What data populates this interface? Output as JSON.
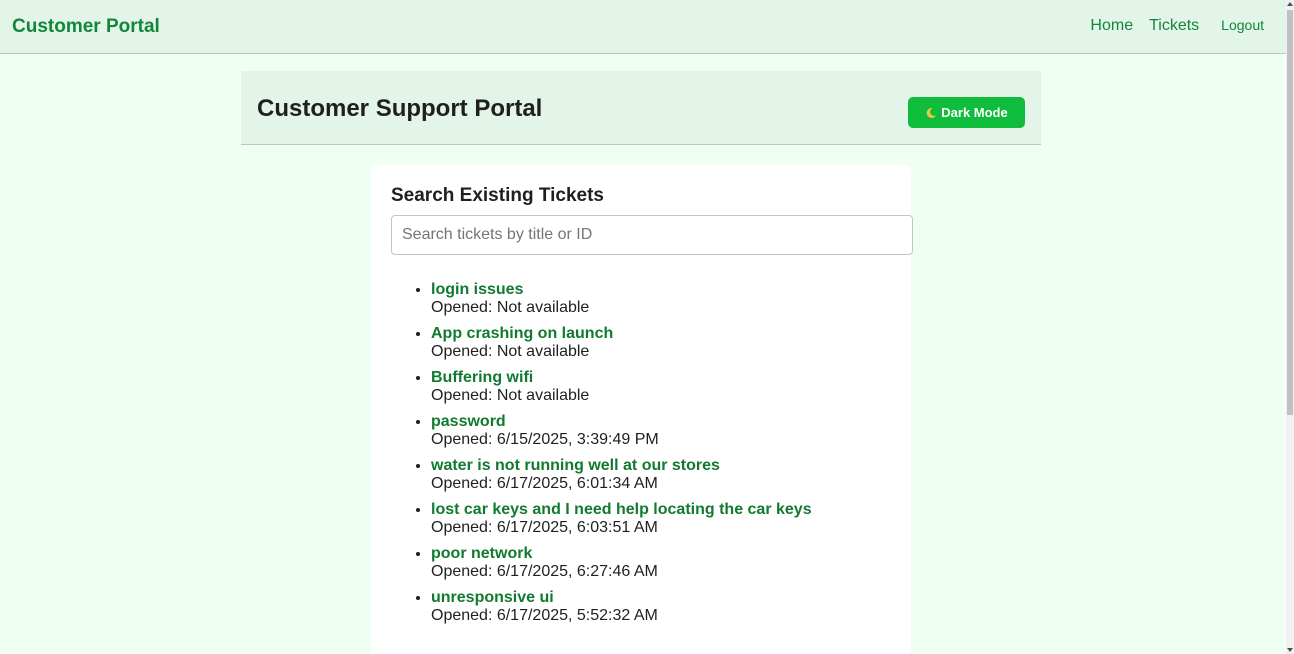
{
  "nav": {
    "brand": "Customer Portal",
    "links": [
      "Home",
      "Tickets"
    ],
    "logout": "Logout"
  },
  "header": {
    "title": "Customer Support Portal",
    "dark_mode_label": "Dark Mode",
    "dark_mode_icon": "moon-icon"
  },
  "search": {
    "title": "Search Existing Tickets",
    "placeholder": "Search tickets by title or ID",
    "value": ""
  },
  "tickets": [
    {
      "title": "login issues",
      "opened": "Opened: Not available"
    },
    {
      "title": "App crashing on launch",
      "opened": "Opened: Not available"
    },
    {
      "title": "Buffering wifi",
      "opened": "Opened: Not available"
    },
    {
      "title": "password",
      "opened": "Opened: 6/15/2025, 3:39:49 PM"
    },
    {
      "title": "water is not running well at our stores",
      "opened": "Opened: 6/17/2025, 6:01:34 AM"
    },
    {
      "title": "lost car keys and I need help locating the car keys",
      "opened": "Opened: 6/17/2025, 6:03:51 AM"
    },
    {
      "title": "poor network",
      "opened": "Opened: 6/17/2025, 6:27:46 AM"
    },
    {
      "title": "unresponsive ui",
      "opened": "Opened: 6/17/2025, 5:52:32 AM"
    }
  ],
  "colors": {
    "background": "#f0fff4",
    "panel": "#e2f5e8",
    "accent": "#14863a",
    "button": "#0fbc3c",
    "ticket_link": "#127a2f"
  }
}
